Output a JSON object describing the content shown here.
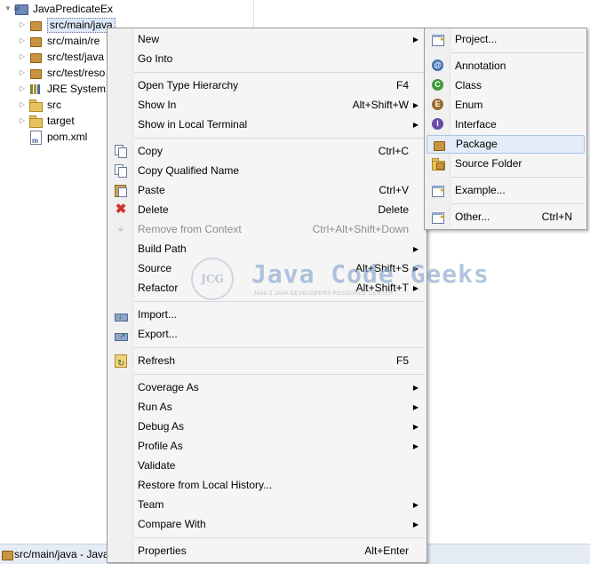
{
  "explorer": {
    "project": "JavaPredicateEx",
    "items": [
      {
        "label": "src/main/java",
        "icon": "package-folder-icon",
        "selected": true
      },
      {
        "label": "src/main/re",
        "icon": "package-folder-icon"
      },
      {
        "label": "src/test/java",
        "icon": "package-folder-icon"
      },
      {
        "label": "src/test/reso",
        "icon": "package-folder-icon"
      },
      {
        "label": "JRE System L",
        "icon": "library-icon"
      },
      {
        "label": "src",
        "icon": "folder-icon"
      },
      {
        "label": "target",
        "icon": "folder-icon"
      },
      {
        "label": "pom.xml",
        "icon": "maven-file-icon"
      }
    ]
  },
  "context_menu": {
    "items": [
      {
        "label": "New",
        "shortcut": "",
        "submenu": true
      },
      {
        "label": "Go Into",
        "shortcut": ""
      },
      {
        "label": "Open Type Hierarchy",
        "shortcut": "F4"
      },
      {
        "label": "Show In",
        "shortcut": "Alt+Shift+W",
        "submenu": true
      },
      {
        "label": "Show in Local Terminal",
        "shortcut": "",
        "submenu": true
      },
      {
        "label": "Copy",
        "shortcut": "Ctrl+C",
        "icon": "copy-icon"
      },
      {
        "label": "Copy Qualified Name",
        "shortcut": "",
        "icon": "copy-icon"
      },
      {
        "label": "Paste",
        "shortcut": "Ctrl+V",
        "icon": "paste-icon"
      },
      {
        "label": "Delete",
        "shortcut": "Delete",
        "icon": "delete-icon"
      },
      {
        "label": "Remove from Context",
        "shortcut": "Ctrl+Alt+Shift+Down",
        "disabled": true,
        "icon": "remove-context-icon"
      },
      {
        "label": "Build Path",
        "shortcut": "",
        "submenu": true
      },
      {
        "label": "Source",
        "shortcut": "Alt+Shift+S",
        "submenu": true
      },
      {
        "label": "Refactor",
        "shortcut": "Alt+Shift+T",
        "submenu": true
      },
      {
        "label": "Import...",
        "shortcut": "",
        "icon": "import-icon"
      },
      {
        "label": "Export...",
        "shortcut": "",
        "icon": "export-icon"
      },
      {
        "label": "Refresh",
        "shortcut": "F5",
        "icon": "refresh-icon"
      },
      {
        "label": "Coverage As",
        "shortcut": "",
        "submenu": true
      },
      {
        "label": "Run As",
        "shortcut": "",
        "submenu": true
      },
      {
        "label": "Debug As",
        "shortcut": "",
        "submenu": true
      },
      {
        "label": "Profile As",
        "shortcut": "",
        "submenu": true
      },
      {
        "label": "Validate",
        "shortcut": ""
      },
      {
        "label": "Restore from Local History...",
        "shortcut": ""
      },
      {
        "label": "Team",
        "shortcut": "",
        "submenu": true
      },
      {
        "label": "Compare With",
        "shortcut": "",
        "submenu": true
      },
      {
        "label": "Properties",
        "shortcut": "Alt+Enter"
      }
    ]
  },
  "submenu": {
    "items": [
      {
        "label": "Project...",
        "shortcut": "",
        "icon": "new-project-icon"
      },
      {
        "label": "Annotation",
        "shortcut": "",
        "icon": "annotation-icon"
      },
      {
        "label": "Class",
        "shortcut": "",
        "icon": "class-icon"
      },
      {
        "label": "Enum",
        "shortcut": "",
        "icon": "enum-icon"
      },
      {
        "label": "Interface",
        "shortcut": "",
        "icon": "interface-icon"
      },
      {
        "label": "Package",
        "shortcut": "",
        "icon": "package-icon",
        "highlighted": true
      },
      {
        "label": "Source Folder",
        "shortcut": "",
        "icon": "source-folder-icon"
      },
      {
        "label": "Example...",
        "shortcut": "",
        "icon": "example-icon"
      },
      {
        "label": "Other...",
        "shortcut": "Ctrl+N",
        "icon": "other-wizard-icon"
      }
    ]
  },
  "watermark": {
    "logo": "JCG",
    "brand": "Java Code Geeks",
    "tagline": "JAVA 2 JAVA DEVELOPERS RESOURCE CENTER"
  },
  "status": {
    "text": "src/main/java - Java"
  },
  "colors": {
    "highlight": "#e3ecf7",
    "menu_bg": "#f5f5f5",
    "status_bg": "#e6ecf5"
  }
}
